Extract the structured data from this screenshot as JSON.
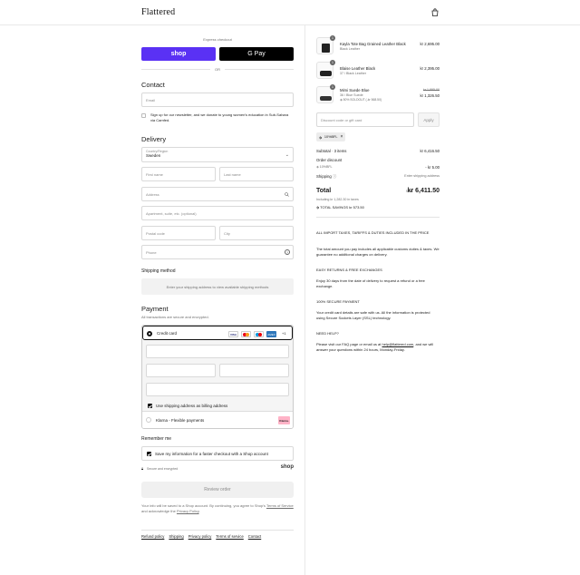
{
  "brand": {
    "logo": "Flattered"
  },
  "express": {
    "label": "Express checkout",
    "shop_pay": "shop",
    "gpay": "G Pay",
    "or": "OR"
  },
  "contact": {
    "title": "Contact",
    "email_placeholder": "Email",
    "newsletter": "Sign up for our newsletter, and we donate to young women's education in Sub-Sahara via Camfed."
  },
  "delivery": {
    "title": "Delivery",
    "country_label": "Country/Region",
    "country_value": "Sweden",
    "first_name": "First name",
    "last_name": "Last name",
    "address": "Address",
    "apartment": "Apartment, suite, etc. (optional)",
    "postal": "Postal code",
    "city": "City",
    "phone": "Phone"
  },
  "shipping": {
    "title": "Shipping method",
    "notice": "Enter your shipping address to view available shipping methods"
  },
  "payment": {
    "title": "Payment",
    "subtitle": "All transactions are secure and encrypted.",
    "credit_card": "Credit card",
    "card_more": "+1",
    "billing_same": "Use shipping address as billing address",
    "klarna": "Klarna - Flexible payments",
    "klarna_badge": "Klarna.",
    "card_icons": [
      "VISA",
      "MC",
      "MAESTRO",
      "AMEX"
    ]
  },
  "remember": {
    "title": "Remember me",
    "save_info": "Save my information for a faster checkout with a Shop account",
    "secure": "Secure and encrypted",
    "shop": "shop"
  },
  "review_button": "Review order",
  "legal": {
    "line1": "Your info will be saved to a Shop account. By continuing, you agree to Shop's",
    "terms": "Terms of Service",
    "and": "and acknowledge the",
    "privacy": "Privacy Policy",
    "end": "."
  },
  "footer_links": [
    "Refund policy",
    "Shipping",
    "Privacy policy",
    "Terms of service",
    "Contact"
  ],
  "cart": {
    "items": [
      {
        "qty": "1",
        "name": "Kayla Tote Bag Grained Leather Black",
        "variant": "Black Leather",
        "price": "kr 2,695.00"
      },
      {
        "qty": "1",
        "name": "Blaise Leather Black",
        "variant": "37 / Black Leather",
        "price": "kr 2,395.00"
      },
      {
        "qty": "1",
        "name": "Mimi Suede Blue",
        "variant": "36 / Blue Suede",
        "discount": "50% SOLDOUT (-kr 568.50)",
        "price_old": "kr 1,895.00",
        "price": "kr 1,326.50"
      }
    ],
    "discount_placeholder": "Discount code or gift card",
    "apply": "Apply",
    "code_tag": "10%BFL",
    "subtotal_label": "Subtotal · 3 items",
    "subtotal_value": "kr 6,416.50",
    "order_discount_label": "Order discount",
    "order_discount_code": "10%BFL",
    "order_discount_value": "- kr 5.00",
    "shipping_label": "Shipping",
    "shipping_value": "Enter shipping address",
    "total_label": "Total",
    "total_currency": "SEK",
    "total_value": "kr 6,411.50",
    "taxes": "Including kr 1,282.30 in taxes",
    "savings": "TOTAL SAVINGS kr 573.50"
  },
  "info": [
    {
      "heading": "ALL IMPORT TAXES, TARIFFS & DUTIES INCLUDED IN THE PRICE",
      "body": "The total amount you pay includes all applicable customs duties & taxes. We guarantee no additional charges on delivery."
    },
    {
      "heading": "EASY RETURNS & FREE EXCHANGES",
      "body": "Enjoy 30 days from the date of delivery to request a refund or a free exchange."
    },
    {
      "heading": "100% SECURE PAYMENT",
      "body": "Your credit card details are safe with us. All the information is protected using Secure Sockets Layer (SSL) technology."
    },
    {
      "heading": "NEED HELP?",
      "body_pre": "Please visit our FAQ page or email us at",
      "email": "help@flattered.com",
      "body_post": ", and we will answer your questions within 24 hours, Monday-Friday."
    }
  ],
  "colors": {
    "shop_purple": "#5a31f4",
    "gpay_black": "#000000",
    "klarna_pink": "#ffb3c7",
    "amex_blue": "#2e77bb"
  }
}
